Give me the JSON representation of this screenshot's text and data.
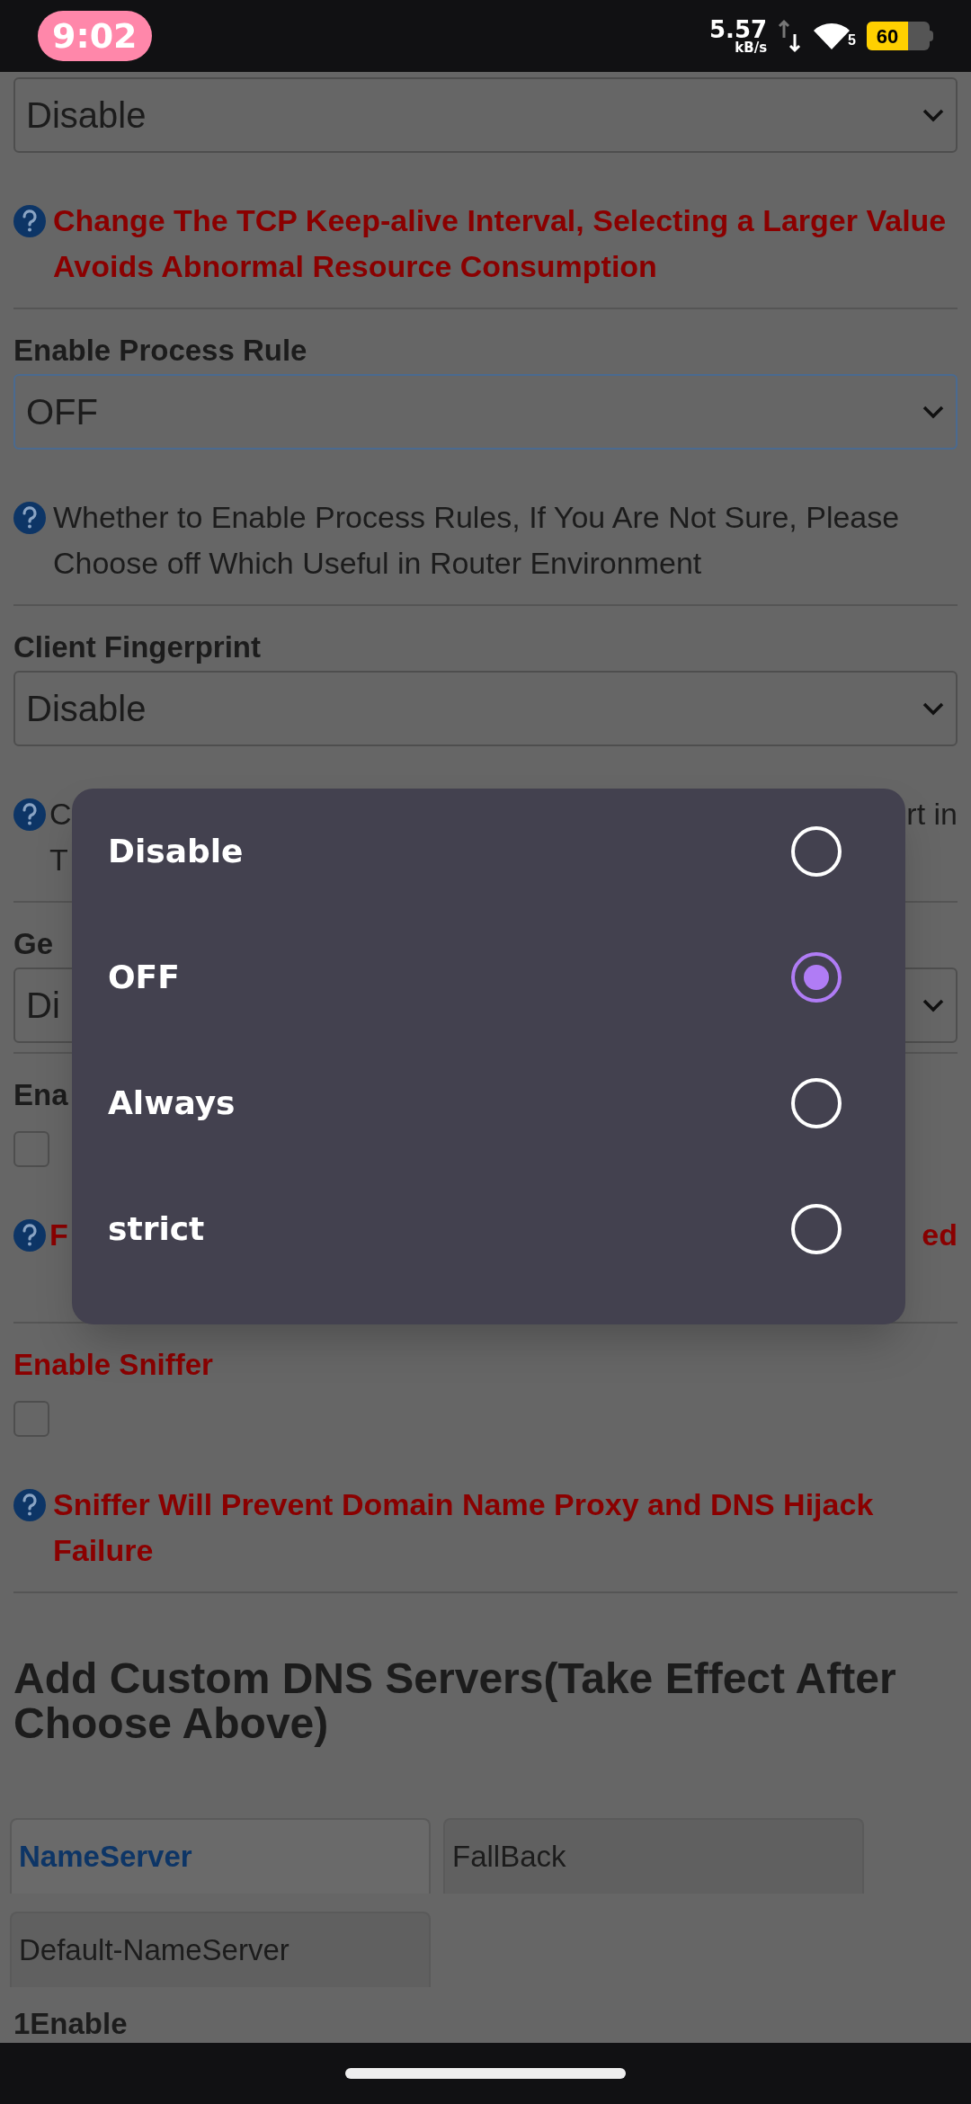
{
  "status_bar": {
    "time": "9:02",
    "speed": "5.57",
    "speed_unit": "kB/s",
    "wifi_level": "5",
    "battery": "60"
  },
  "sections": [
    {
      "kind": "setting",
      "select": "Disable",
      "focused": false,
      "help": {
        "important": true,
        "text": "Change The TCP Keep-alive Interval, Selecting a Larger Value Avoids Abnormal Resource Consumption"
      }
    },
    {
      "kind": "setting",
      "label": "Enable Process Rule",
      "select": "OFF",
      "focused": true,
      "help": {
        "important": false,
        "text": "Whether to Enable Process Rules, If You Are Not Sure, Please Choose off Which Useful in Router Environment"
      }
    },
    {
      "kind": "setting",
      "label": "Client Fingerprint",
      "select": "Disable",
      "focused": false,
      "help": {
        "important": false,
        "kind": "partial",
        "left": "C",
        "right": "rt in",
        "line2": "T"
      }
    },
    {
      "kind": "setting",
      "label": "Ge",
      "select": "Di",
      "focused": false
    },
    {
      "kind": "checkbox",
      "label": "Ena",
      "important_label": false,
      "checked": false,
      "help": {
        "important": true,
        "kind": "partial",
        "left": "F",
        "right": "ed"
      }
    },
    {
      "kind": "checkbox",
      "label": "Enable Sniffer",
      "important_label": true,
      "checked": false,
      "help": {
        "important": true,
        "text": "Sniffer Will Prevent Domain Name Proxy and DNS Hijack Failure"
      }
    }
  ],
  "heading": "Add Custom DNS Servers(Take Effect After Choose Above)",
  "tabs": [
    {
      "label": "NameServer",
      "selected": true
    },
    {
      "label": "FallBack",
      "selected": false
    },
    {
      "label": "Default-NameServer",
      "selected": false
    }
  ],
  "next_label": "1Enable",
  "dialog": {
    "options": [
      {
        "label": "Disable",
        "selected": false
      },
      {
        "label": "OFF",
        "selected": true
      },
      {
        "label": "Always",
        "selected": false
      },
      {
        "label": "strict",
        "selected": false
      }
    ]
  }
}
